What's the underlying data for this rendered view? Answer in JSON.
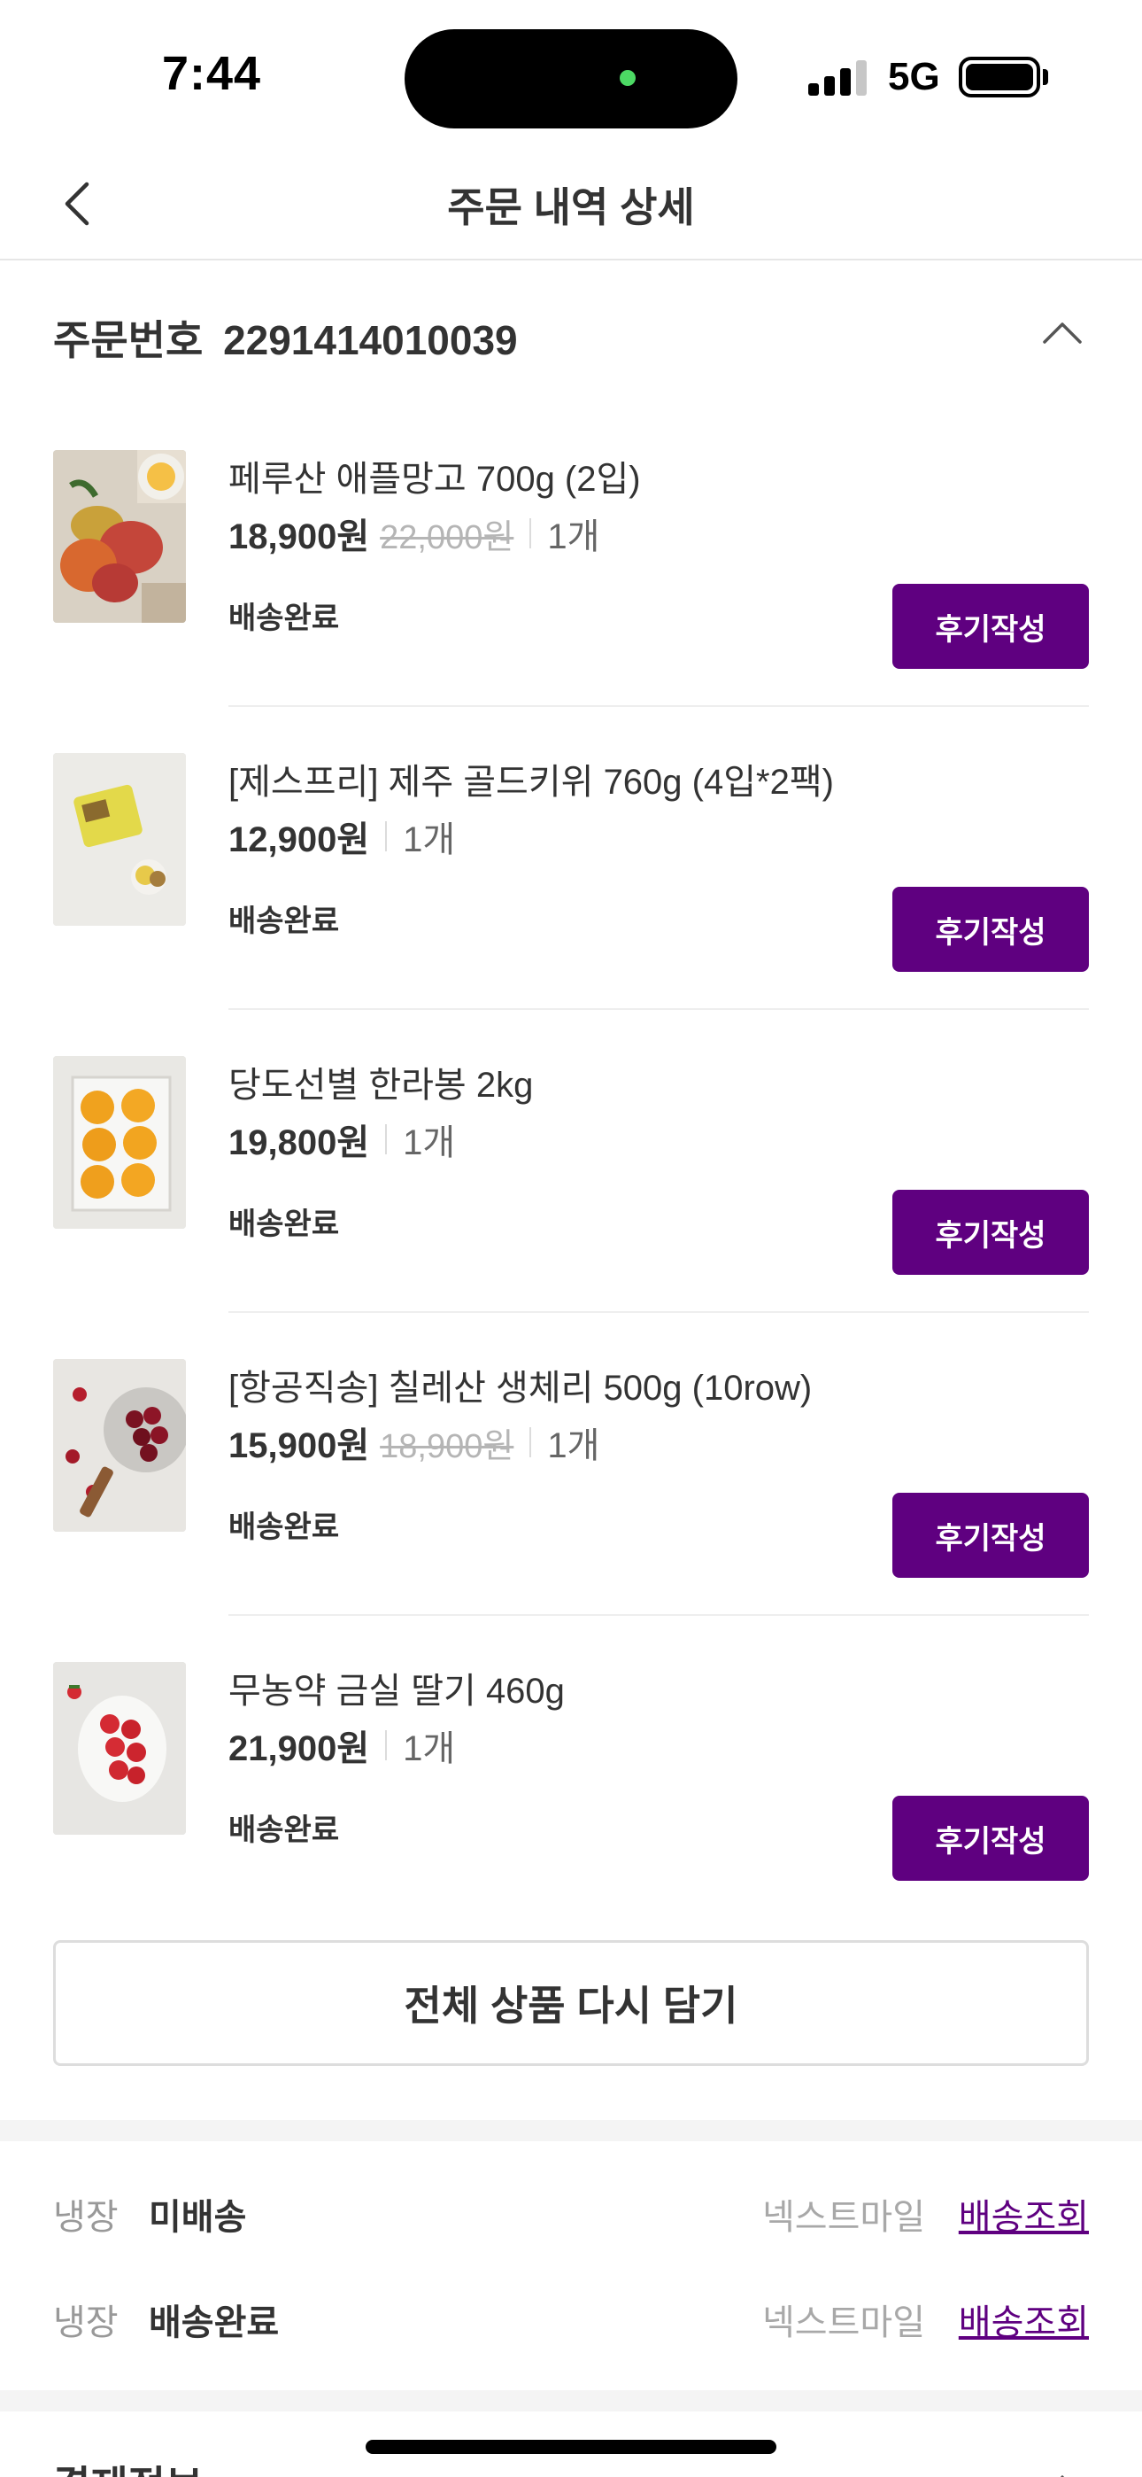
{
  "status_bar": {
    "time": "7:44",
    "network": "5G"
  },
  "nav": {
    "title": "주문 내역 상세"
  },
  "order": {
    "number_label": "주문번호",
    "number": "2291414010039"
  },
  "products": [
    {
      "name": "페루산 애플망고 700g (2입)",
      "price": "18,900원",
      "original_price": "22,000원",
      "quantity": "1개",
      "status": "배송완료",
      "review_label": "후기작성",
      "thumb": "mango"
    },
    {
      "name": "[제스프리] 제주 골드키위 760g (4입*2팩)",
      "price": "12,900원",
      "original_price": "",
      "quantity": "1개",
      "status": "배송완료",
      "review_label": "후기작성",
      "thumb": "kiwi"
    },
    {
      "name": "당도선별 한라봉 2kg",
      "price": "19,800원",
      "original_price": "",
      "quantity": "1개",
      "status": "배송완료",
      "review_label": "후기작성",
      "thumb": "hallabong"
    },
    {
      "name": "[항공직송] 칠레산 생체리 500g (10row)",
      "price": "15,900원",
      "original_price": "18,900원",
      "quantity": "1개",
      "status": "배송완료",
      "review_label": "후기작성",
      "thumb": "cherry"
    },
    {
      "name": "무농약 금실 딸기 460g",
      "price": "21,900원",
      "original_price": "",
      "quantity": "1개",
      "status": "배송완료",
      "review_label": "후기작성",
      "thumb": "strawberry"
    }
  ],
  "readd_all_label": "전체 상품 다시 담기",
  "deliveries": [
    {
      "type": "냉장",
      "state": "미배송",
      "carrier": "넥스트마일",
      "track_label": "배송조회"
    },
    {
      "type": "냉장",
      "state": "배송완료",
      "carrier": "넥스트마일",
      "track_label": "배송조회"
    }
  ],
  "payment": {
    "title": "결제정보"
  },
  "colors": {
    "brand": "#5f0080",
    "text_primary": "#333333",
    "text_muted": "#999999"
  }
}
